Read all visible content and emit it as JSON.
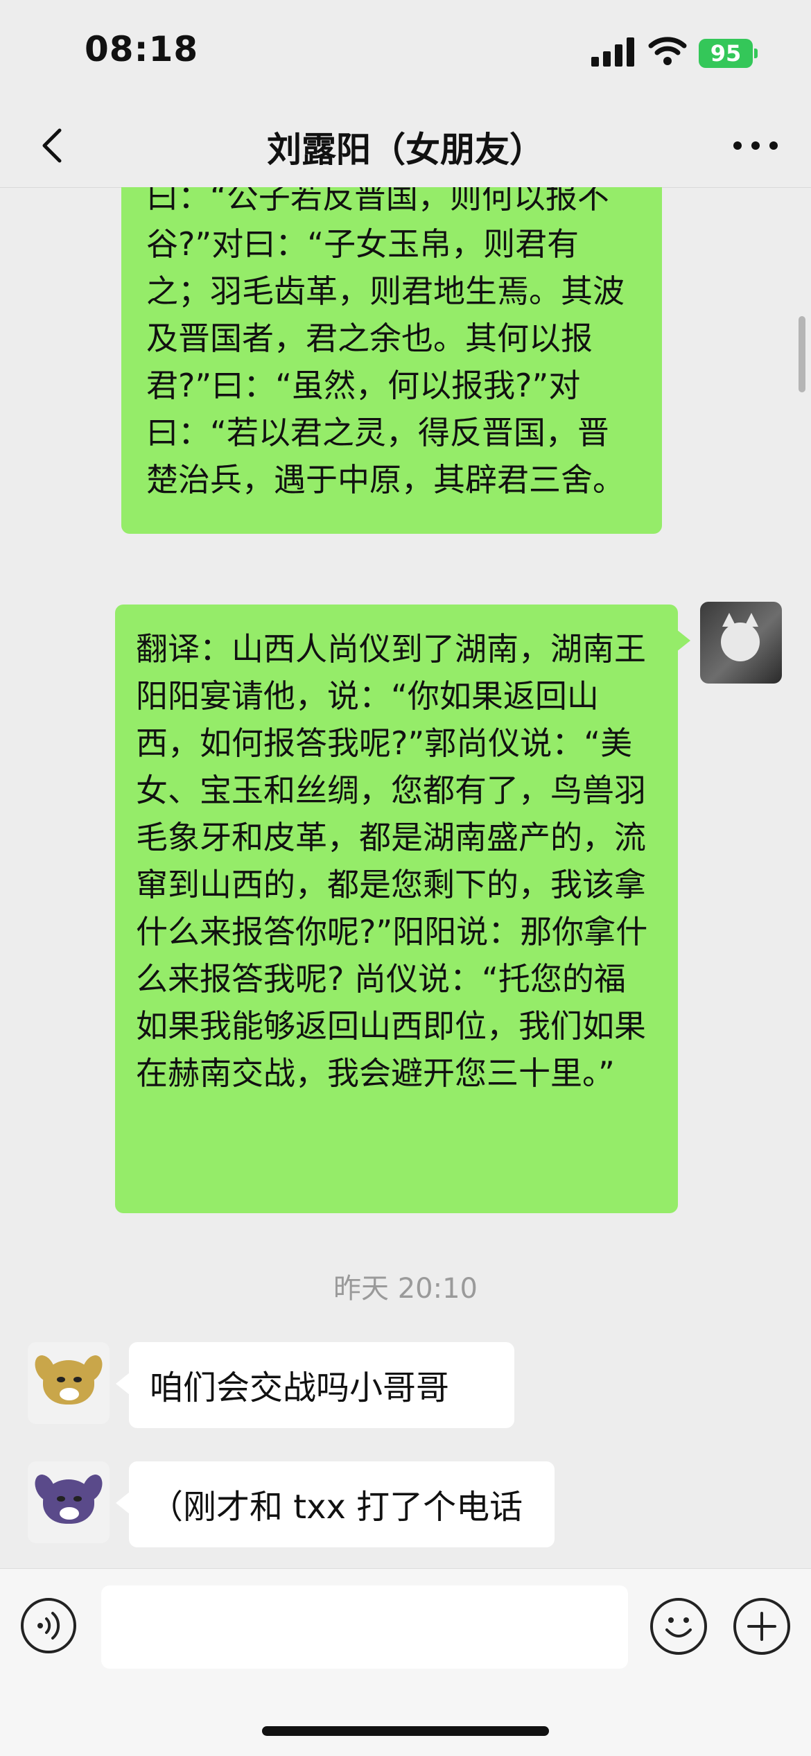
{
  "status_bar": {
    "time": "08:18",
    "battery": "95"
  },
  "header": {
    "title": "刘露阳（女朋友）"
  },
  "messages": {
    "top_partial": "曰：“公子若反晋国，则何以报不谷?”对曰：“子女玉帛，则君有之；羽毛齿革，则君地生焉。其波及晋国者，君之余也。其何以报君?”曰：“虽然，何以报我?”对曰：“若以君之灵，得反晋国，晋楚治兵，遇于中原，其辟君三舍。",
    "sent_translation": "翻译：山西人尚仪到了湖南，湖南王阳阳宴请他，说：“你如果返回山西，如何报答我呢?”郭尚仪说：“美女、宝玉和丝绸，您都有了，鸟兽羽毛象牙和皮革，都是湖南盛产的，流窜到山西的，都是您剩下的，我该拿什么来报答你呢?”阳阳说：那你拿什么来报答我呢? 尚仪说：“托您的福如果我能够返回山西即位，我们如果在赫南交战，我会避开您三十里。”",
    "timestamp": "昨天 20:10",
    "received": [
      {
        "text": "咱们会交战吗小哥哥"
      },
      {
        "text": "（刚才和 txx 打了个电话"
      }
    ]
  },
  "input": {
    "value": "",
    "placeholder": ""
  },
  "icons": {
    "back": "chevron-left-icon",
    "more": "more-horizontal-icon",
    "voice": "voice-icon",
    "emoji": "emoji-icon",
    "plus": "plus-icon"
  },
  "colors": {
    "sent_bubble": "#95ec69",
    "received_bubble": "#ffffff",
    "background": "#ededed",
    "battery": "#34c759"
  }
}
